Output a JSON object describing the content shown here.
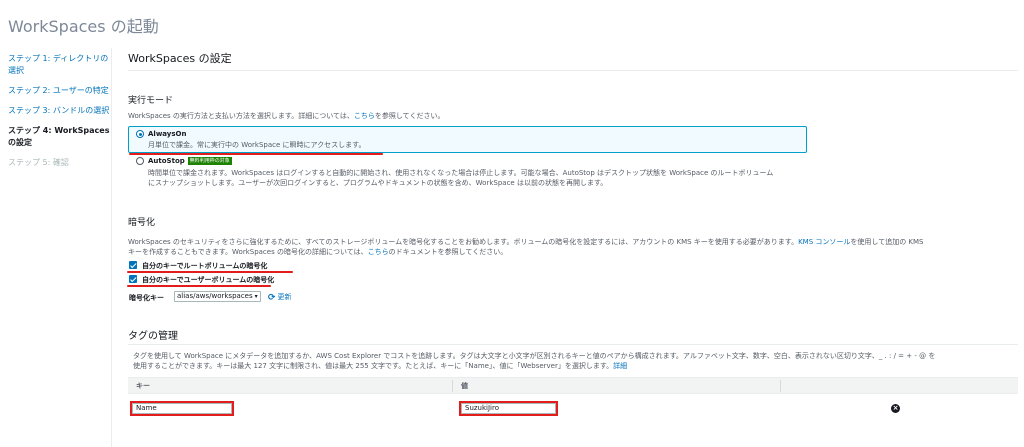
{
  "page": {
    "title": "WorkSpaces の起動"
  },
  "sidebar": {
    "items": [
      {
        "label": "ステップ 1: ディレクトリの選択"
      },
      {
        "label": "ステップ 2: ユーザーの特定"
      },
      {
        "label": "ステップ 3: バンドルの選択"
      },
      {
        "label": "ステップ 4: WorkSpaces の設定"
      },
      {
        "label": "ステップ 5: 確認"
      }
    ]
  },
  "main": {
    "title": "WorkSpaces の設定"
  },
  "running_mode": {
    "heading": "実行モード",
    "desc_prefix": "WorkSpaces の実行方法と支払い方法を選択します。詳細については、",
    "desc_link": "こちら",
    "desc_suffix": "を参照してください。",
    "always_on": {
      "label": "AlwaysOn",
      "desc": "月単位で課金。常に実行中の WorkSpace に瞬時にアクセスします。"
    },
    "auto_stop": {
      "label": "AutoStop",
      "badge": "無料利用枠の対象",
      "desc_line1": "時間単位で課金されます。WorkSpaces はログインすると自動的に開始され、使用されなくなった場合は停止します。可能な場合、AutoStop はデスクトップ状態を WorkSpace のルートボリューム",
      "desc_line2": "にスナップショットします。ユーザーが次回ログインすると、プログラムやドキュメントの状態を含め、WorkSpace は以前の状態を再開します。"
    }
  },
  "encryption": {
    "heading": "暗号化",
    "desc_line1_prefix": "WorkSpaces のセキュリティをさらに強化するために、すべてのストレージボリュームを暗号化することをお勧めします。ボリュームの暗号化を設定するには、アカウントの KMS キーを使用する必要があります。",
    "desc_line1_link": "KMS コンソール",
    "desc_line1_suffix": "を使用して追加の KMS",
    "desc_line2_prefix": "キーを作成することもできます。WorkSpaces の暗号化の詳細については、",
    "desc_line2_link": "こちら",
    "desc_line2_suffix": "のドキュメントを参照してください。",
    "root_volume": "自分のキーでルートボリュームの暗号化",
    "user_volume": "自分のキーでユーザーボリュームの暗号化",
    "key_label": "暗号化キー",
    "key_value": "alias/aws/workspaces",
    "refresh": "更新"
  },
  "tags": {
    "heading": "タグの管理",
    "desc_line1": "タグを使用して WorkSpace にメタデータを追加するか、AWS Cost Explorer でコストを追跡します。タグは大文字と小文字が区別されるキーと値のペアから構成されます。アルファベット文字、数字、空白、表示されない区切り文字、_ . : / = + - @ を",
    "desc_line2_prefix": "使用することができます。キーは最大 127 文字に制限され、値は最大 255 文字です。たとえば、キーに「Name」、値に「Webserver」を選択します。",
    "desc_line2_link": "詳細",
    "col_key": "キー",
    "col_value": "値",
    "row": {
      "key": "Name",
      "value": "SuzukiJiro"
    }
  },
  "colors": {
    "accent": "#0073bb",
    "highlight": "#e31c1c",
    "badge": "#1d8102"
  }
}
